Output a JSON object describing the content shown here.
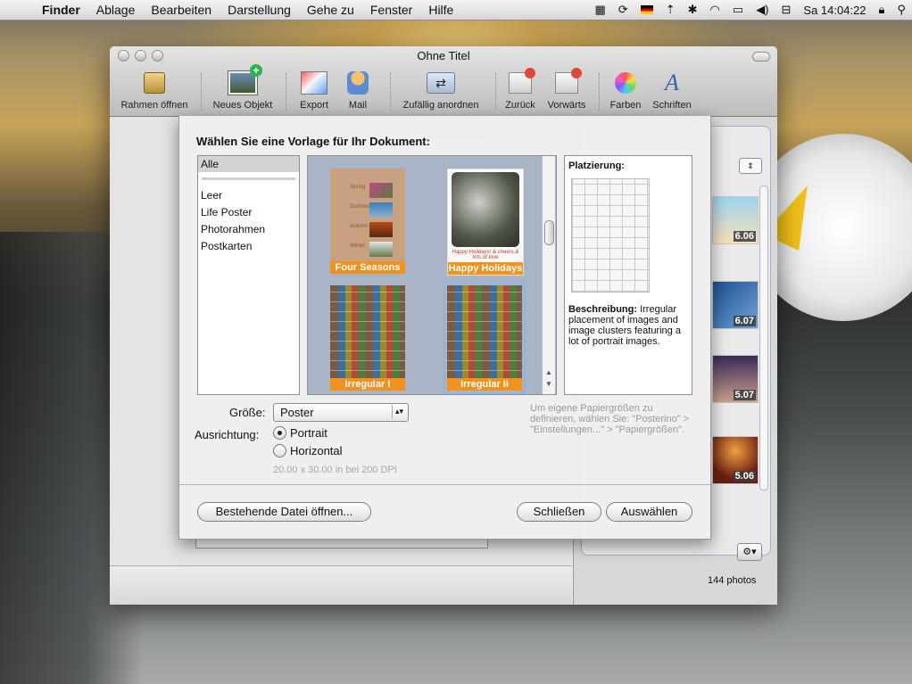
{
  "menubar": {
    "app": "Finder",
    "items": [
      "Ablage",
      "Bearbeiten",
      "Darstellung",
      "Gehe zu",
      "Fenster",
      "Hilfe"
    ],
    "clock": "Sa 14:04:22"
  },
  "window": {
    "title": "Ohne Titel",
    "toolbar": {
      "frame_open": "Rahmen öffnen",
      "new_object": "Neues Objekt",
      "export": "Export",
      "mail": "Mail",
      "shuffle": "Zufällig anordnen",
      "back": "Zurück",
      "forward": "Vorwärts",
      "colors": "Farben",
      "fonts": "Schriften"
    }
  },
  "photos_panel": {
    "thumb_labels": [
      "6.06",
      "6.07",
      "5.07",
      "5.06"
    ],
    "count": "144 photos"
  },
  "sheet": {
    "title": "Wählen Sie eine Vorlage für Ihr Dokument:",
    "categories": {
      "selected": "Alle",
      "items": [
        "Leer",
        "Life Poster",
        "Photorahmen",
        "Postkarten"
      ]
    },
    "templates": [
      {
        "label": "Four Seasons",
        "seasons": [
          "Spring",
          "Summer",
          "Autumn",
          "Winter"
        ]
      },
      {
        "label": "Happy Holidays",
        "caption": "Happy Holidays! & cheers & lots of love"
      },
      {
        "label": "Irregular I"
      },
      {
        "label": "Irregular II"
      }
    ],
    "placement": {
      "heading": "Platzierung:",
      "desc_label": "Beschreibung:",
      "desc_text": " Irregular placement of images and image clusters featuring a lot of portrait images."
    },
    "size_label": "Größe:",
    "size_value": "Poster",
    "orientation_label": "Ausrichtung:",
    "orientation_portrait": "Portrait",
    "orientation_landscape": "Horizontal",
    "dimensions": "20.00 x 30.00 in bei 200 DPI",
    "hint": "Um eigene Papiergrößen zu definieren, wählen Sie: \"Posterino\" > \"Einstellungen...\" > \"Papiergrößen\".",
    "btn_open": "Bestehende Datei öffnen...",
    "btn_close": "Schließen",
    "btn_choose": "Auswählen"
  }
}
